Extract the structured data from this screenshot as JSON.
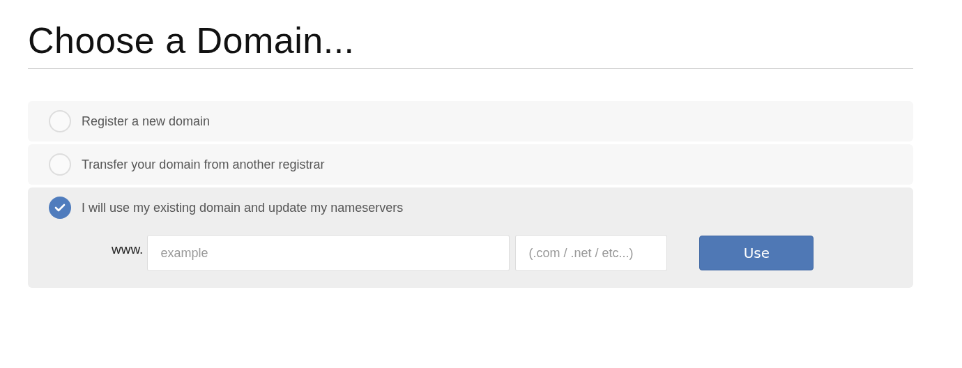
{
  "title": "Choose a Domain...",
  "options": [
    {
      "label": "Register a new domain",
      "selected": false
    },
    {
      "label": "Transfer your domain from another registrar",
      "selected": false
    },
    {
      "label": "I will use my existing domain and update my nameservers",
      "selected": true,
      "form": {
        "prefix": "www.",
        "name_placeholder": "example",
        "tld_placeholder": "(.com / .net / etc...)",
        "button": "Use"
      }
    }
  ]
}
